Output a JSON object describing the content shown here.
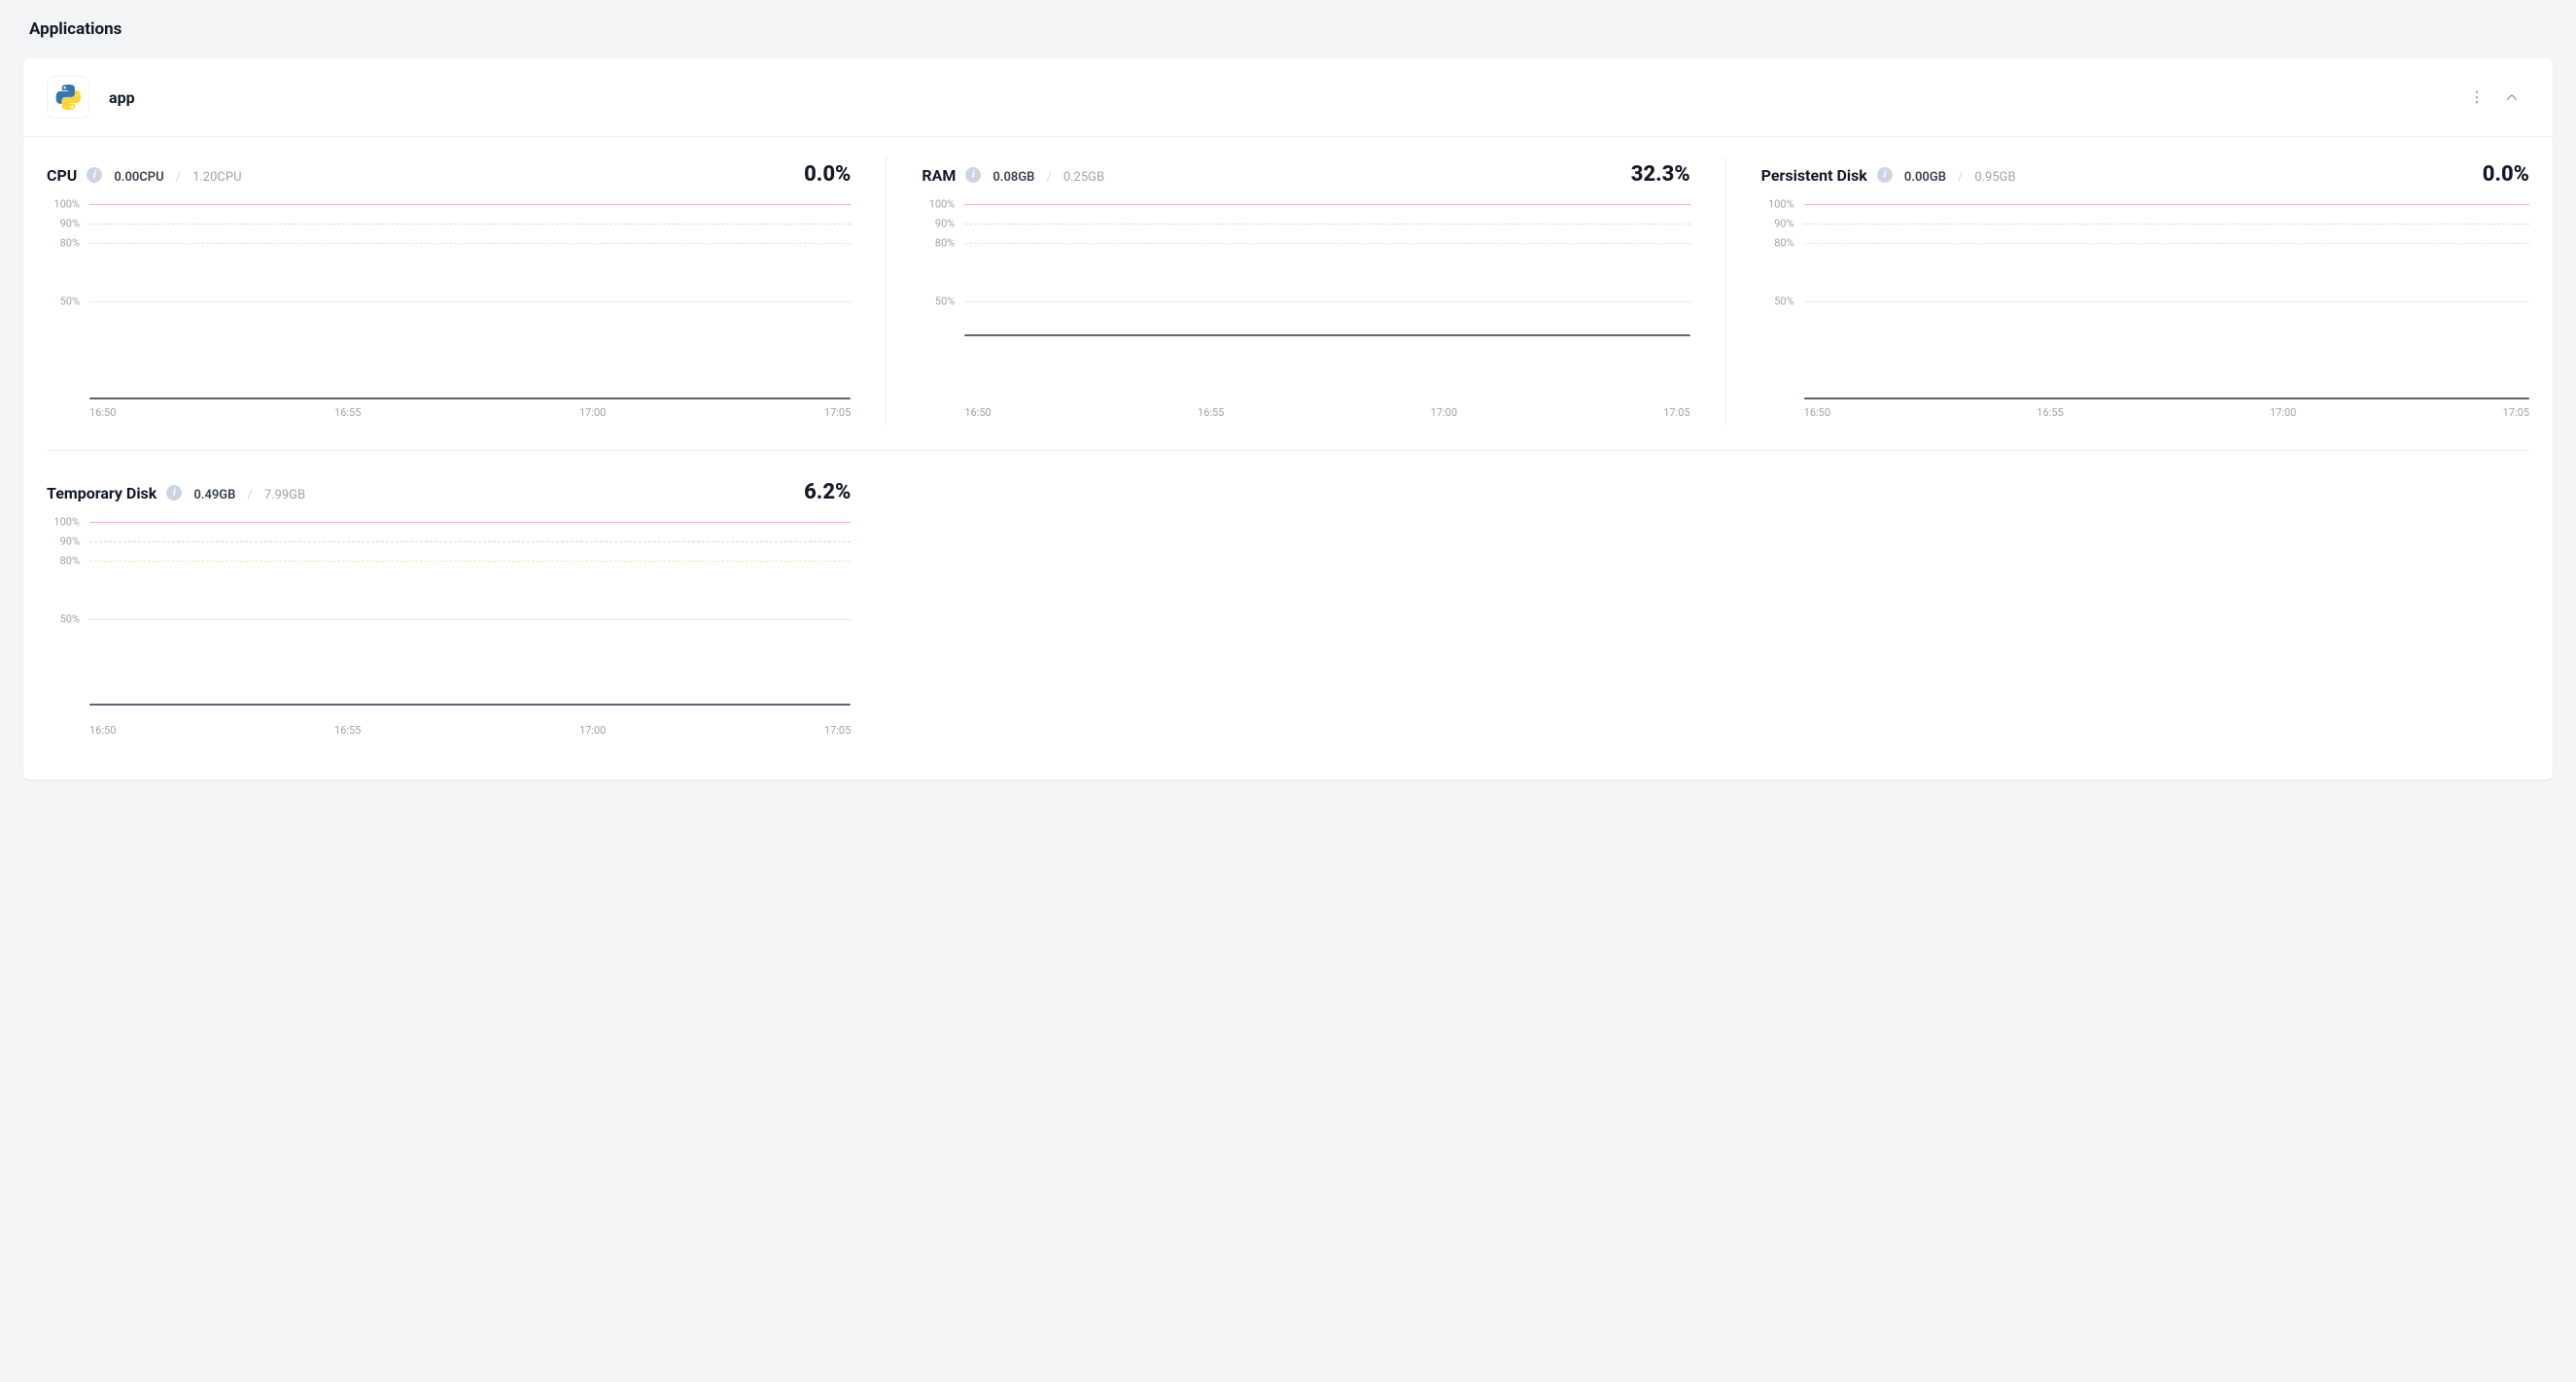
{
  "page_title": "Applications",
  "app": {
    "name": "app",
    "icon": "python-icon"
  },
  "x_ticks": [
    "16:50",
    "16:55",
    "17:00",
    "17:05"
  ],
  "y_ticks": [
    {
      "label": "100%",
      "pct": 100,
      "cls": "grid-100"
    },
    {
      "label": "90%",
      "pct": 90,
      "cls": "grid-90"
    },
    {
      "label": "80%",
      "pct": 80,
      "cls": "grid-80"
    },
    {
      "label": "50%",
      "pct": 50,
      "cls": "grid-50"
    }
  ],
  "metrics": {
    "cpu": {
      "title": "CPU",
      "used": "0.00CPU",
      "limit": "1.20CPU",
      "pct_label": "0.0%",
      "pct_value": 0.0
    },
    "ram": {
      "title": "RAM",
      "used": "0.08GB",
      "limit": "0.25GB",
      "pct_label": "32.3%",
      "pct_value": 32.3
    },
    "pdisk": {
      "title": "Persistent Disk",
      "used": "0.00GB",
      "limit": "0.95GB",
      "pct_label": "0.0%",
      "pct_value": 0.0
    },
    "tdisk": {
      "title": "Temporary Disk",
      "used": "0.49GB",
      "limit": "7.99GB",
      "pct_label": "6.2%",
      "pct_value": 6.2
    }
  },
  "chart_data": [
    {
      "type": "line",
      "title": "CPU",
      "xlabel": "",
      "ylabel": "",
      "ylim": [
        0,
        100
      ],
      "categories": [
        "16:50",
        "16:55",
        "17:00",
        "17:05"
      ],
      "values": [
        0.0,
        0.0,
        0.0,
        0.0
      ],
      "gridlines": [
        100,
        90,
        80,
        50
      ]
    },
    {
      "type": "line",
      "title": "RAM",
      "xlabel": "",
      "ylabel": "",
      "ylim": [
        0,
        100
      ],
      "categories": [
        "16:50",
        "16:55",
        "17:00",
        "17:05"
      ],
      "values": [
        32.3,
        32.3,
        32.3,
        32.3
      ],
      "gridlines": [
        100,
        90,
        80,
        50
      ]
    },
    {
      "type": "line",
      "title": "Persistent Disk",
      "xlabel": "",
      "ylabel": "",
      "ylim": [
        0,
        100
      ],
      "categories": [
        "16:50",
        "16:55",
        "17:00",
        "17:05"
      ],
      "values": [
        0.0,
        0.0,
        0.0,
        0.0
      ],
      "gridlines": [
        100,
        90,
        80,
        50
      ]
    },
    {
      "type": "line",
      "title": "Temporary Disk",
      "xlabel": "",
      "ylabel": "",
      "ylim": [
        0,
        100
      ],
      "categories": [
        "16:50",
        "16:55",
        "17:00",
        "17:05"
      ],
      "values": [
        6.2,
        6.2,
        6.2,
        6.2
      ],
      "gridlines": [
        100,
        90,
        80,
        50
      ]
    }
  ]
}
